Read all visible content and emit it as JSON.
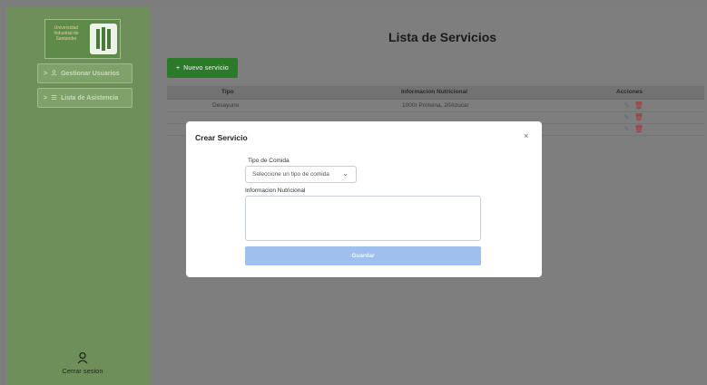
{
  "sidebar": {
    "logo_text": "Universidad Industrial de Santander",
    "items": [
      {
        "label": "Gestionar Usuarios",
        "chevron": ">",
        "icon": "user-icon"
      },
      {
        "label": "Lista de Asistencia",
        "chevron": ">",
        "icon": "list-icon"
      }
    ],
    "logout_label": "Cerrar sesion"
  },
  "main": {
    "title": "Lista de Servicios",
    "new_button_label": "Nuevo servicio",
    "table": {
      "headers": [
        "Tipo",
        "Informacion Nutricional",
        "Acciones"
      ],
      "rows": [
        {
          "tipo": "Desayuno",
          "info": "1000r Proteina, 20Azucar"
        },
        {
          "tipo": "",
          "info": ""
        },
        {
          "tipo": "",
          "info": ""
        }
      ]
    }
  },
  "modal": {
    "title": "Crear Servicio",
    "close_symbol": "×",
    "food_type_label": "Tipo de Comida",
    "food_type_selected": "Seleccione un tipo de comida",
    "nutrition_label": "Informacion Nutricional",
    "nutrition_value": "",
    "save_label": "Guardar"
  },
  "colors": {
    "sidebar": "#6e8e5a",
    "primary_green": "#2a7a2a",
    "save_button": "#9fc0ee",
    "delete_icon": "#a83030"
  }
}
